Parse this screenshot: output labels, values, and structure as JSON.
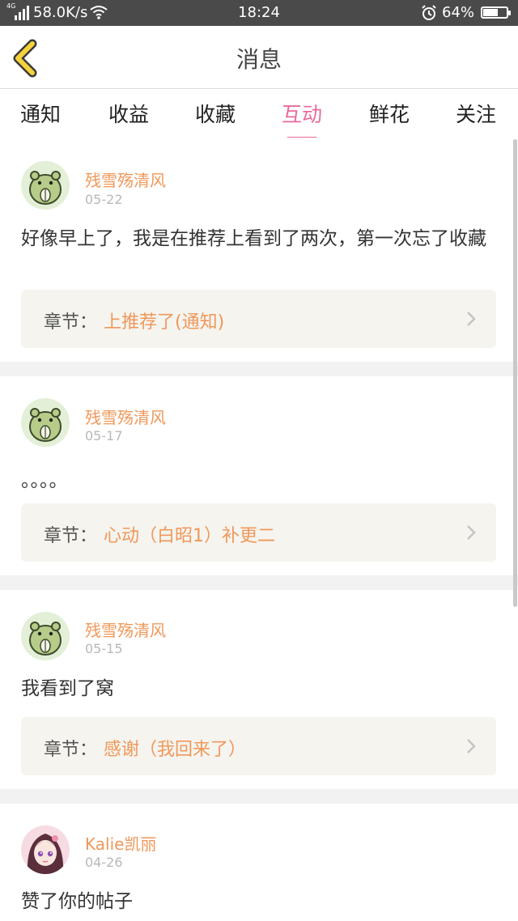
{
  "status_bar": {
    "network": "4G",
    "speed": "58.0K/s",
    "time": "18:24",
    "battery_text": "64%",
    "battery_level": 0.64
  },
  "header": {
    "title": "消息"
  },
  "tabs": [
    {
      "label": "通知",
      "active": false
    },
    {
      "label": "收益",
      "active": false
    },
    {
      "label": "收藏",
      "active": false
    },
    {
      "label": "互动",
      "active": true
    },
    {
      "label": "鲜花",
      "active": false
    },
    {
      "label": "关注",
      "active": false
    }
  ],
  "messages": [
    {
      "user": "残雪殇清风",
      "date": "05-22",
      "content": "好像早上了，我是在推荐上看到了两次，第一次忘了收藏",
      "chapter_label": "章节：",
      "chapter_title": "上推荐了(通知)"
    },
    {
      "user": "残雪殇清风",
      "date": "05-17",
      "content": "。。。。",
      "chapter_label": "章节：",
      "chapter_title": "心动（白昭1）补更二"
    },
    {
      "user": "残雪殇清风",
      "date": "05-15",
      "content": "我看到了窝",
      "chapter_label": "章节：",
      "chapter_title": "感谢（我回来了）"
    },
    {
      "user": "Kalie凯丽",
      "date": "04-26",
      "content": "赞了你的帖子"
    }
  ],
  "colors": {
    "accent": "#e96a9c",
    "username": "#f0985a",
    "back_arrow": "#f5d23c"
  }
}
